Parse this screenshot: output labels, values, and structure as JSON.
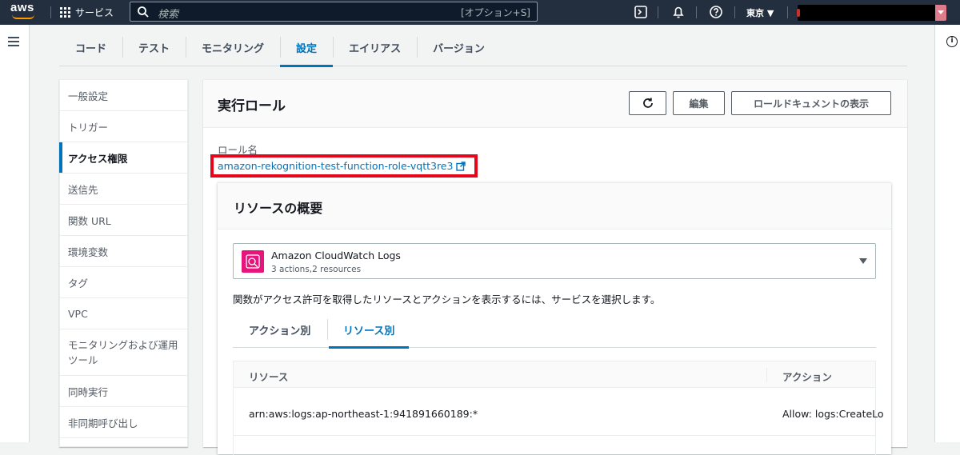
{
  "topbar": {
    "logo_text": "aws",
    "services_label": "サービス",
    "search_placeholder": "検索",
    "search_shortcut": "[オプション+S]",
    "region": "東京 ▼",
    "icons": [
      "cloudshell-icon",
      "bell-icon",
      "help-icon"
    ]
  },
  "tabs": [
    {
      "label": "コード",
      "active": false
    },
    {
      "label": "テスト",
      "active": false
    },
    {
      "label": "モニタリング",
      "active": false
    },
    {
      "label": "設定",
      "active": true
    },
    {
      "label": "エイリアス",
      "active": false
    },
    {
      "label": "バージョン",
      "active": false
    }
  ],
  "sidenav": [
    {
      "label": "一般設定"
    },
    {
      "label": "トリガー"
    },
    {
      "label": "アクセス権限",
      "active": true
    },
    {
      "label": "送信先"
    },
    {
      "label": "関数 URL"
    },
    {
      "label": "環境変数"
    },
    {
      "label": "タグ"
    },
    {
      "label": "VPC"
    },
    {
      "label": "モニタリングおよび運用ツール",
      "tall": true
    },
    {
      "label": "同時実行"
    },
    {
      "label": "非同期呼び出し"
    }
  ],
  "panel": {
    "title": "実行ロール",
    "edit_label": "編集",
    "view_doc_label": "ロールドキュメントの表示",
    "role_label": "ロール名",
    "role_name": "amazon-rekognition-test-function-role-vqtt3re3"
  },
  "resource_summary": {
    "title": "リソースの概要",
    "service_name": "Amazon CloudWatch Logs",
    "service_sub": "3 actions,2 resources",
    "hint": "関数がアクセス許可を取得したリソースとアクションを表示するには、サービスを選択します。",
    "subtab_actions": "アクション別",
    "subtab_resources": "リソース別",
    "col_resource": "リソース",
    "col_action": "アクション",
    "row_resource": "arn:aws:logs:ap-northeast-1:941891660189:*",
    "row_action": "Allow: logs:CreateLo"
  },
  "colors": {
    "accent": "#0073bb",
    "highlight_box": "#e4061b",
    "topbar": "#232f3e",
    "cloudwatch": "#e7157b"
  }
}
